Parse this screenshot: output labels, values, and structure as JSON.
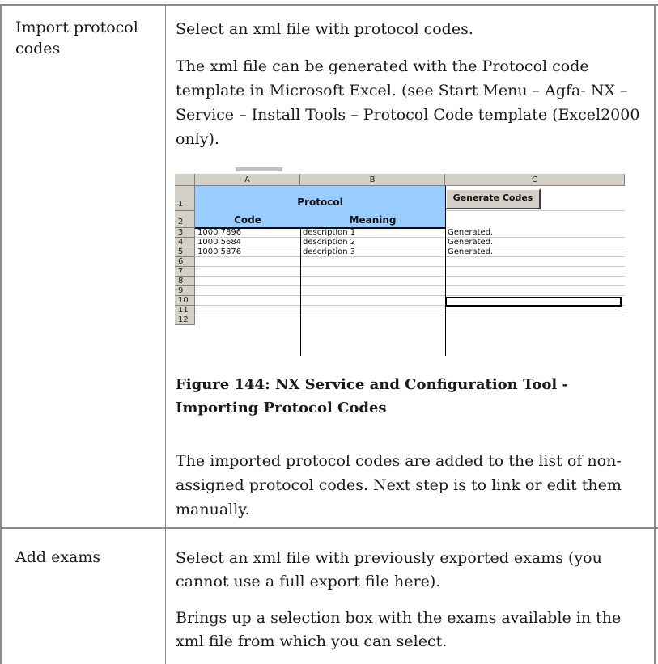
{
  "rows": [
    {
      "label": "Import protocol codes",
      "paragraphs": [
        "Select an xml file with protocol codes.",
        "The xml file can be generated with the Protocol code template in Microsoft Excel. (see Start Menu – Agfa- NX – Service – Install Tools – Protocol Code template (Excel2000 only).",
        "The imported protocol codes are added to the list of non-assigned protocol codes. Next step is to link or edit them manually."
      ],
      "figure": {
        "caption": "Figure 144: NX Service and Configuration Tool - Importing Protocol Codes",
        "spreadsheet": {
          "column_headers": [
            "A",
            "B",
            "C"
          ],
          "row_numbers": [
            "1",
            "2",
            "3",
            "4",
            "5",
            "6",
            "7",
            "8",
            "9",
            "10",
            "11",
            "12"
          ],
          "group_header": "Protocol",
          "header_code": "Code",
          "header_meaning": "Meaning",
          "button_label": "Generate Codes",
          "data": [
            {
              "code": "1000 7896",
              "meaning": "description 1",
              "status": "Generated."
            },
            {
              "code": "1000 5684",
              "meaning": "description 2",
              "status": "Generated."
            },
            {
              "code": "1000 5876",
              "meaning": "description 3",
              "status": "Generated."
            }
          ],
          "header_fill_color": "#99ccff"
        }
      }
    },
    {
      "label": "Add exams",
      "paragraphs": [
        "Select an xml file with previously exported exams (you cannot use a full export file here).",
        "Brings up a selection box with the exams available in the xml file from which you can select."
      ]
    }
  ]
}
